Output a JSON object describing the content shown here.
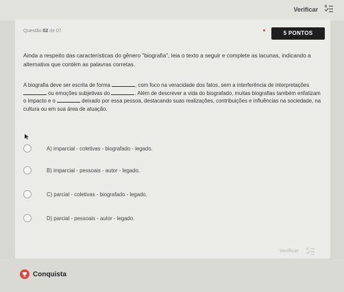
{
  "header": {
    "verify_label": "Verificar",
    "verify_icon": "checklist-icon"
  },
  "question": {
    "number_prefix": "Questão",
    "number": "02",
    "total_text": "de 07",
    "points": "5 PONTOS",
    "prompt": "Ainda a respeito das características do gênero \"biografia\", leia o texto a seguir e complete as lacunas, indicando a alternativa que contém as palavras corretas.",
    "passage": [
      "A biografia deve ser escrita de forma ",
      ", com foco na veracidade dos fatos, sem a interferência de interpretações ",
      " ou emoções subjetivas do ",
      ". Além de descrever a vida do biografado, muitas biografias também enfatizam o impacto e o ",
      " deixado por essa pessoa, destacando suas realizações, contribuições e influências na sociedade, na cultura ou em sua área de atuação."
    ]
  },
  "options": [
    {
      "label": "A) imparcial - coletivas - biografado - legado."
    },
    {
      "label": "B) imparcial - pessoais - autor - legado."
    },
    {
      "label": "C) parcial - coletivas - biografado - legado."
    },
    {
      "label": "D) parcial - pessoais - autor - legado."
    }
  ],
  "footer": {
    "verify_label": "Verificar",
    "achievement_label": "Conquista",
    "achievement_icon": "trophy-icon"
  },
  "colors": {
    "badge_bg": "#1f1f1f",
    "achievement_red": "#d9473f",
    "card_bg": "#ebebe7"
  }
}
